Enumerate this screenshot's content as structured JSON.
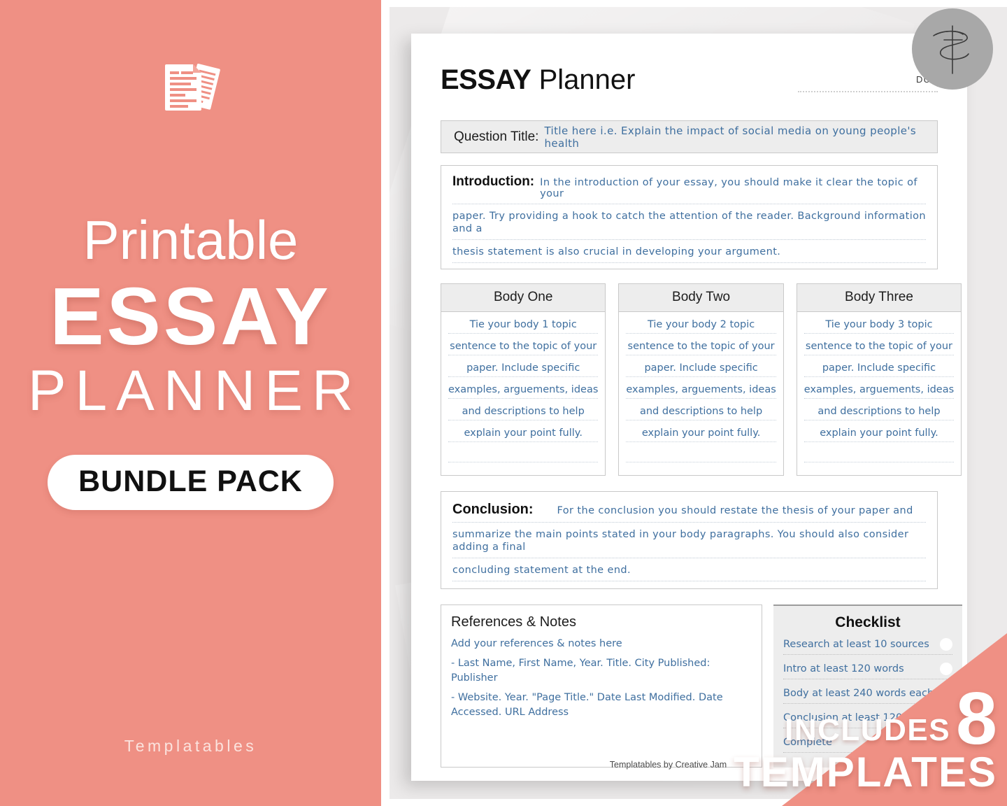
{
  "colors": {
    "coral": "#ef9084",
    "stage_grey": "#eceaea",
    "hand_blue": "#3f6f9f",
    "box_grey": "#ededed",
    "logo_grey": "#a8a8a8"
  },
  "promo": {
    "icon": "documents-icon",
    "line1": "Printable",
    "line2": "ESSAY",
    "line3": "PLANNER",
    "badge": "BUNDLE PACK",
    "brand": "Templatables"
  },
  "corner_badge": {
    "includes": "INCLUDES",
    "count": "8",
    "templates": "TEMPLATES"
  },
  "logo": {
    "name": "templatables-monogram-logo",
    "initials": "TS"
  },
  "document": {
    "title_bold": "ESSAY",
    "title_light": "Planner",
    "due_label": "DUE",
    "due_value": "",
    "question": {
      "label": "Question Title:",
      "value": "Title here i.e. Explain the impact of social media on young people's health"
    },
    "introduction": {
      "label": "Introduction:",
      "lines": [
        "In the introduction of your essay, you should make it clear the topic of your",
        "paper. Try providing a hook to catch the attention of the reader. Background information and a",
        "thesis statement is also crucial in developing your argument."
      ]
    },
    "bodies": [
      {
        "heading": "Body One",
        "lines": [
          "Tie your body 1 topic",
          "sentence to the topic of your",
          "paper. Include specific",
          "examples, arguements, ideas",
          "and descriptions to help",
          "explain your point fully.",
          ""
        ]
      },
      {
        "heading": "Body Two",
        "lines": [
          "Tie your body 2 topic",
          "sentence to the topic of your",
          "paper. Include specific",
          "examples, arguements, ideas",
          "and descriptions to help",
          "explain your point fully.",
          ""
        ]
      },
      {
        "heading": "Body Three",
        "lines": [
          "Tie your body 3 topic",
          "sentence to the topic of your",
          "paper. Include specific",
          "examples, arguements, ideas",
          "and descriptions to help",
          "explain your point fully.",
          ""
        ]
      }
    ],
    "conclusion": {
      "label": "Conclusion:",
      "lines": [
        "For the conclusion you should restate the thesis of your paper and",
        "summarize the main points stated in your body paragraphs. You should also consider adding a final",
        "concluding statement at the end."
      ]
    },
    "references": {
      "heading": "References & Notes",
      "lines": [
        "Add your references & notes here",
        "- Last Name, First Name, Year. Title. City Published: Publisher",
        "- Website. Year. \"Page Title.\" Date Last Modified. Date Accessed. URL Address"
      ]
    },
    "checklist": {
      "heading": "Checklist",
      "items": [
        "Research at least 10 sources",
        "Intro at least 120 words",
        "Body at least 240 words each",
        "Conclusion at least 120 words",
        "Complete"
      ]
    },
    "footer": "Templatables by Creative Jam"
  }
}
